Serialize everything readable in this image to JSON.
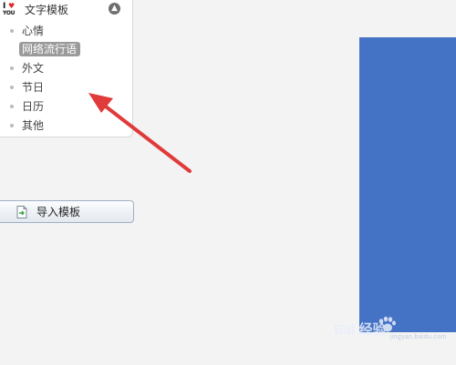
{
  "panel": {
    "logo_text_top": "I",
    "logo_heart": "♥",
    "logo_text_bottom": "YOU",
    "title": "文字模板",
    "collapse_icon": "chevron-up-icon"
  },
  "categories": [
    {
      "label": "心情",
      "selected": false
    },
    {
      "label": "网络流行语",
      "selected": true
    },
    {
      "label": "外文",
      "selected": false
    },
    {
      "label": "节日",
      "selected": false
    },
    {
      "label": "日历",
      "selected": false
    },
    {
      "label": "其他",
      "selected": false
    }
  ],
  "import_button": {
    "label": "导入模板",
    "icon": "import-file-icon"
  },
  "watermark": {
    "text": "Bai  经验",
    "sub": "jingyan.baidu.com"
  },
  "colors": {
    "accent_blue": "#4472c4",
    "selected_bg": "#9a9a9a",
    "arrow": "#e03a3a"
  }
}
